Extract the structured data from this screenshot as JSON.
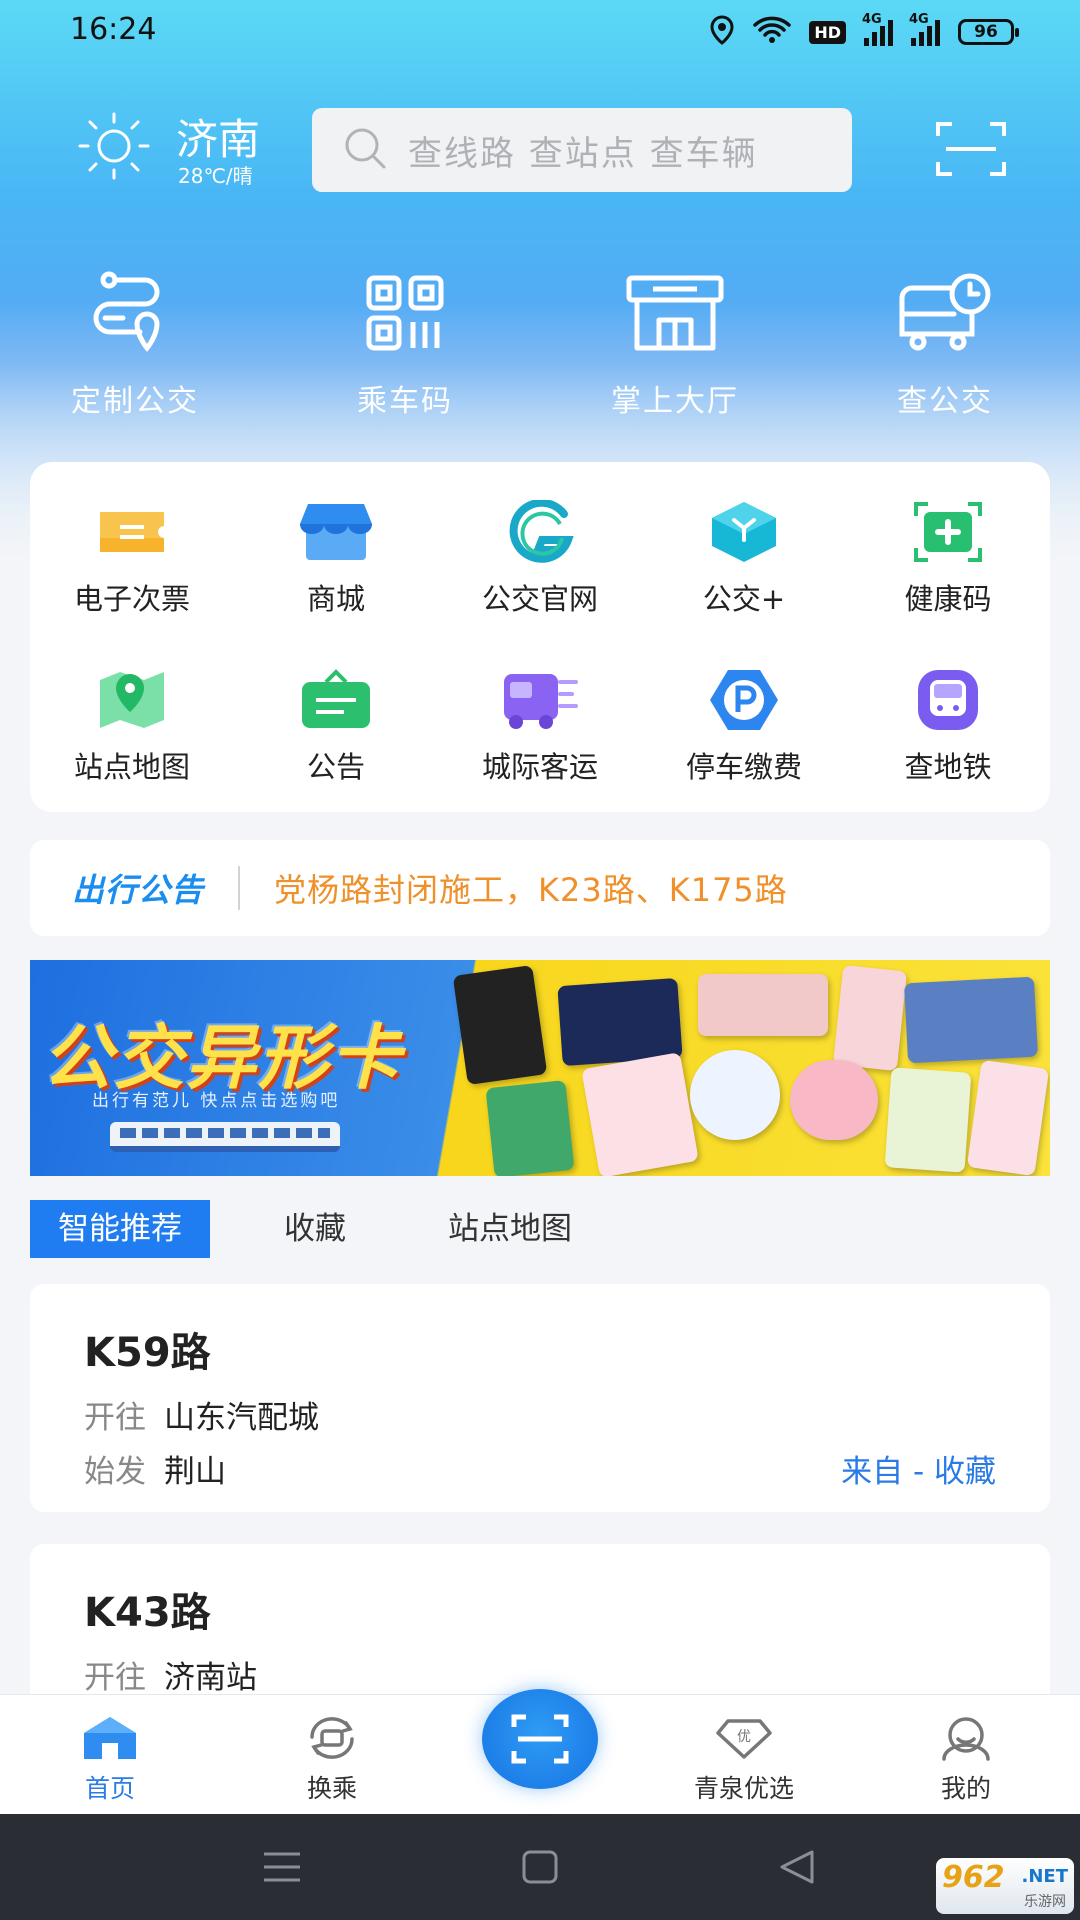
{
  "status_bar": {
    "time": "16:24",
    "hd": "HD",
    "net1": "4G",
    "net2": "4G",
    "battery": "96"
  },
  "header": {
    "city": "济南",
    "weather": "28℃/晴",
    "search_placeholder": "查线路 查站点 查车辆",
    "icons": {
      "weather": "sun-icon",
      "search": "search-icon",
      "scan": "scan-icon"
    }
  },
  "quick_actions": [
    {
      "label": "定制公交",
      "icon": "custom-bus-icon"
    },
    {
      "label": "乘车码",
      "icon": "qr-code-icon"
    },
    {
      "label": "掌上大厅",
      "icon": "hall-icon"
    },
    {
      "label": "查公交",
      "icon": "bus-clock-icon"
    }
  ],
  "services": [
    {
      "label": "电子次票",
      "icon": "ticket-icon",
      "color": "#f7b32b"
    },
    {
      "label": "商城",
      "icon": "shop-icon",
      "color": "#2f8cf0"
    },
    {
      "label": "公交官网",
      "icon": "g-logo-icon",
      "color": "#1aa8c9"
    },
    {
      "label": "公交+",
      "icon": "cube-icon",
      "color": "#17b8d6"
    },
    {
      "label": "健康码",
      "icon": "health-code-icon",
      "color": "#28c070"
    },
    {
      "label": "站点地图",
      "icon": "map-pin-icon",
      "color": "#2fc37a"
    },
    {
      "label": "公告",
      "icon": "announcement-icon",
      "color": "#2bbf6e"
    },
    {
      "label": "城际客运",
      "icon": "coach-icon",
      "color": "#8a63f2"
    },
    {
      "label": "停车缴费",
      "icon": "parking-icon",
      "color": "#2d86f0"
    },
    {
      "label": "查地铁",
      "icon": "metro-icon",
      "color": "#7a5cf0"
    }
  ],
  "notice": {
    "tag": "出行公告",
    "text": "党杨路封闭施工，K23路、K175路"
  },
  "banner": {
    "title": "公交异形卡",
    "subtitle": "出行有范儿 快点点击选购吧"
  },
  "tabs": [
    "智能推荐",
    "收藏",
    "站点地图"
  ],
  "routes": [
    {
      "name": "K59路",
      "to_label": "开往",
      "to": "山东汽配城",
      "from_label": "始发",
      "from": "荆山",
      "source": "来自 - 收藏"
    },
    {
      "name": "K43路",
      "to_label": "开往",
      "to": "济南站"
    }
  ],
  "nav": [
    {
      "label": "首页",
      "icon": "home-icon",
      "active": true
    },
    {
      "label": "换乘",
      "icon": "transfer-icon"
    },
    {
      "label": "青泉优选",
      "icon": "diamond-icon"
    },
    {
      "label": "我的",
      "icon": "profile-icon"
    }
  ],
  "watermark": {
    "brand": "962",
    "net": ".NET",
    "site": "乐游网"
  },
  "colors": {
    "accent": "#1f7cf1",
    "notice_text": "#f0902a",
    "link": "#2a7be6"
  }
}
